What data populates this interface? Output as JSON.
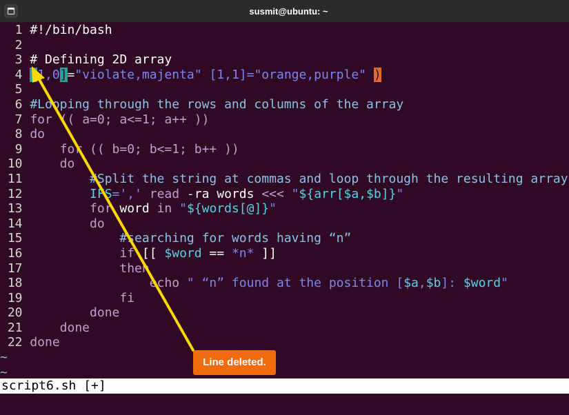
{
  "window": {
    "title": "susmit@ubuntu: ~",
    "menu_icon": "terminal-menu-icon"
  },
  "editor": {
    "lines": [
      {
        "n": "1",
        "segs": [
          {
            "t": "#!/bin/bash",
            "c": "c-w"
          }
        ]
      },
      {
        "n": "2",
        "segs": []
      },
      {
        "n": "3",
        "segs": [
          {
            "t": "# Defining 2D array",
            "c": "c-w"
          }
        ]
      },
      {
        "n": "4",
        "segs": [
          {
            "t": "[",
            "c": "hl"
          },
          {
            "t": "1,0",
            "c": "c-str"
          },
          {
            "t": "]",
            "c": "hl"
          },
          {
            "t": "=",
            "c": "c-op"
          },
          {
            "t": "\"violate,majenta\"",
            "c": "c-str"
          },
          {
            "t": " [1,1]=",
            "c": "c-str"
          },
          {
            "t": "\"orange,purple\"",
            "c": "c-str"
          },
          {
            "t": " ",
            "c": "c-op"
          },
          {
            "t": ")",
            "c": "hl-o"
          }
        ]
      },
      {
        "n": "5",
        "segs": []
      },
      {
        "n": "6",
        "segs": [
          {
            "t": "#Looping through the rows and columns of the array",
            "c": "c-com"
          }
        ]
      },
      {
        "n": "7",
        "segs": [
          {
            "t": "for",
            "c": "c-kw"
          },
          {
            "t": " (( a=0; a<=1; a++ ))",
            "c": "c-kw"
          }
        ]
      },
      {
        "n": "8",
        "segs": [
          {
            "t": "do",
            "c": "c-kw"
          }
        ]
      },
      {
        "n": "9",
        "segs": [
          {
            "t": "    for (( b=0; b<=1; b++ ))",
            "c": "c-kw"
          }
        ]
      },
      {
        "n": "10",
        "segs": [
          {
            "t": "    do",
            "c": "c-kw"
          }
        ]
      },
      {
        "n": "11",
        "segs": [
          {
            "t": "        #Split the string at commas and loop through the resulting array",
            "c": "c-com"
          }
        ]
      },
      {
        "n": "12",
        "segs": [
          {
            "t": "        ",
            "c": "c-op"
          },
          {
            "t": "IFS",
            "c": "c-var"
          },
          {
            "t": "=','",
            "c": "c-str"
          },
          {
            "t": " read",
            "c": "c-kw"
          },
          {
            "t": " -ra",
            "c": "c-w"
          },
          {
            "t": " words",
            "c": "c-w"
          },
          {
            "t": " <<< ",
            "c": "c-kw"
          },
          {
            "t": "\"",
            "c": "c-str"
          },
          {
            "t": "${arr[$a,$b]}",
            "c": "c-var"
          },
          {
            "t": "\"",
            "c": "c-str"
          }
        ]
      },
      {
        "n": "13",
        "segs": [
          {
            "t": "        for",
            "c": "c-kw"
          },
          {
            "t": " word",
            "c": "c-w"
          },
          {
            "t": " in ",
            "c": "c-kw"
          },
          {
            "t": "\"",
            "c": "c-str"
          },
          {
            "t": "${words[@]}",
            "c": "c-var"
          },
          {
            "t": "\"",
            "c": "c-str"
          }
        ]
      },
      {
        "n": "14",
        "segs": [
          {
            "t": "        do",
            "c": "c-kw"
          }
        ]
      },
      {
        "n": "15",
        "segs": [
          {
            "t": "            #searching for words having “n”",
            "c": "c-com"
          }
        ]
      },
      {
        "n": "16",
        "segs": [
          {
            "t": "            if",
            "c": "c-kw"
          },
          {
            "t": " [[ ",
            "c": "c-w"
          },
          {
            "t": "$word",
            "c": "c-var"
          },
          {
            "t": " == ",
            "c": "c-w"
          },
          {
            "t": "*n*",
            "c": "c-str"
          },
          {
            "t": " ]]",
            "c": "c-w"
          }
        ]
      },
      {
        "n": "17",
        "segs": [
          {
            "t": "            then",
            "c": "c-kw"
          }
        ]
      },
      {
        "n": "18",
        "segs": [
          {
            "t": "                echo",
            "c": "c-kw"
          },
          {
            "t": " \" “n” found at the position [",
            "c": "c-str"
          },
          {
            "t": "$a",
            "c": "c-var"
          },
          {
            "t": ",",
            "c": "c-str"
          },
          {
            "t": "$b",
            "c": "c-var"
          },
          {
            "t": "]: ",
            "c": "c-str"
          },
          {
            "t": "$word",
            "c": "c-var"
          },
          {
            "t": "\"",
            "c": "c-str"
          }
        ]
      },
      {
        "n": "19",
        "segs": [
          {
            "t": "            fi",
            "c": "c-kw"
          }
        ]
      },
      {
        "n": "20",
        "segs": [
          {
            "t": "        done",
            "c": "c-kw"
          }
        ]
      },
      {
        "n": "21",
        "segs": [
          {
            "t": "    done",
            "c": "c-kw"
          }
        ]
      },
      {
        "n": "22",
        "segs": [
          {
            "t": "done",
            "c": "c-kw"
          }
        ]
      }
    ],
    "tildes": [
      "~",
      "~"
    ]
  },
  "status": {
    "filename": "script6.sh [+]"
  },
  "annotation": {
    "label": "Line deleted.",
    "color": "#f26b0f",
    "arrow_color": "#ffd900"
  }
}
